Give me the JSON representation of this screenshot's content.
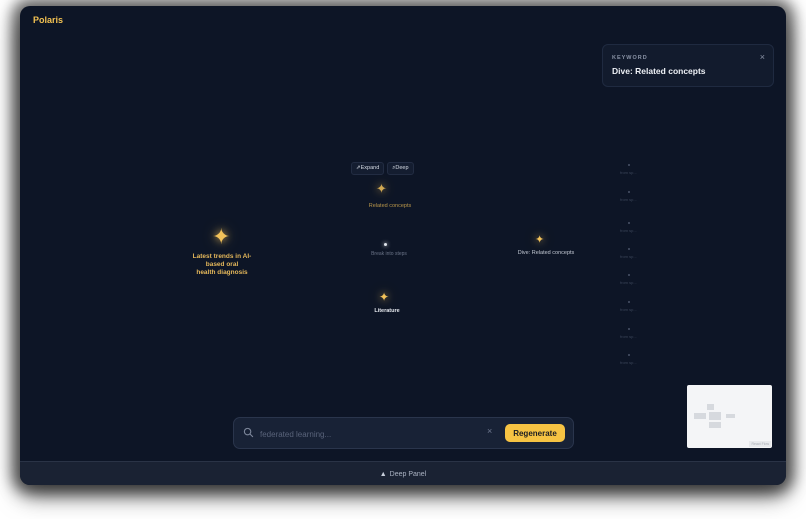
{
  "app": {
    "brand": "Polaris"
  },
  "keyword_panel": {
    "label": "KEYWORD",
    "title": "Dive: Related concepts",
    "close": "×"
  },
  "nodes": {
    "root": {
      "lines": [
        "Latest trends in AI-",
        "based oral",
        "health diagnosis"
      ]
    },
    "related": {
      "label": "Related concepts"
    },
    "break": {
      "label": "Break into steps"
    },
    "literature": {
      "label": "Literature"
    },
    "dive": {
      "label": "Dive: Related concepts"
    }
  },
  "chips": {
    "expand": "Expand",
    "deep": "Deep"
  },
  "side_items": [
    "from sp...",
    "from sp...",
    "from sp...",
    "from sp...",
    "from sp...",
    "from sp...",
    "from sp...",
    "from sp..."
  ],
  "search": {
    "placeholder": "federated learning...",
    "clear": "×",
    "regenerate": "Regenerate"
  },
  "minimap": {
    "tag": "React Flow"
  },
  "deep_panel": {
    "label": "Deep Panel"
  },
  "colors": {
    "accent": "#f6c343",
    "background": "#0d1526"
  }
}
